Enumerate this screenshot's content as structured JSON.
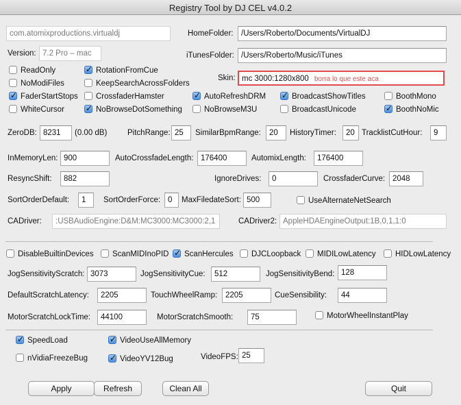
{
  "window": {
    "title": "Registry Tool by DJ CEL v4.0.2"
  },
  "top": {
    "bundle_id": "com.atomixproductions.virtualdj",
    "version_label": "Version:",
    "version_value": "7.2 Pro – mac",
    "home_folder_label": "HomeFolder:",
    "home_folder_value": "/Users/Roberto/Documents/VirtualDJ",
    "itunes_folder_label": "iTunesFolder:",
    "itunes_folder_value": "/Users/Roberto/Music/iTunes",
    "skin_label": "Skin:",
    "skin_value": "mc 3000:1280x800",
    "skin_hint": "borra lo que este aca"
  },
  "checks1": {
    "readonly": "ReadOnly",
    "rotation_from_cue": "RotationFromCue",
    "nomodifiles": "NoModiFiles",
    "keep_search": "KeepSearchAcrossFolders",
    "fader_start_stops": "FaderStartStops",
    "crossfader_hamster": "CrossfaderHamster",
    "auto_refresh_drm": "AutoRefreshDRM",
    "broadcast_show_titles": "BroadcastShowTitles",
    "booth_mono": "BoothMono",
    "white_cursor": "WhiteCursor",
    "no_browse_dot": "NoBrowseDotSomething",
    "no_browse_m3u": "NoBrowseM3U",
    "broadcast_unicode": "BroadcastUnicode",
    "booth_no_mic": "BoothNoMic"
  },
  "fields1": {
    "zerodb_label": "ZeroDB:",
    "zerodb_value": "8231",
    "zerodb_db": "(0.00 dB)",
    "pitch_range_label": "PitchRange:",
    "pitch_range_value": "25",
    "similar_bpm_label": "SimilarBpmRange:",
    "similar_bpm_value": "20",
    "history_timer_label": "HistoryTimer:",
    "history_timer_value": "20",
    "tracklist_cut_label": "TracklistCutHour:",
    "tracklist_cut_value": "9",
    "inmemory_label": "InMemoryLen:",
    "inmemory_value": "900",
    "auto_crossfade_label": "AutoCrossfadeLength:",
    "auto_crossfade_value": "176400",
    "automix_label": "AutomixLength:",
    "automix_value": "176400",
    "resync_label": "ResyncShift:",
    "resync_value": "882",
    "ignore_drives_label": "IgnoreDrives:",
    "ignore_drives_value": "0",
    "crossfader_curve_label": "CrossfaderCurve:",
    "crossfader_curve_value": "2048",
    "sort_default_label": "SortOrderDefault:",
    "sort_default_value": "1",
    "sort_force_label": "SortOrderForce:",
    "sort_force_value": "0",
    "max_filedate_label": "MaxFiledateSort:",
    "max_filedate_value": "500",
    "use_alt_net_search": "UseAlternateNetSearch",
    "cadriver_label": "CADriver:",
    "cadriver_value": ":USBAudioEngine:D&M:MC3000:MC3000:2,1",
    "cadriver2_label": "CADriver2:",
    "cadriver2_value": "AppleHDAEngineOutput:1B,0,1,1:0"
  },
  "checks2": {
    "disable_builtin": "DisableBuiltinDevices",
    "scan_midi_no_pid": "ScanMIDInoPID",
    "scan_hercules": "ScanHercules",
    "djc_loopback": "DJCLoopback",
    "midi_low_latency": "MIDILowLatency",
    "hid_low_latency": "HIDLowLatency"
  },
  "fields2": {
    "jog_scratch_label": "JogSensitivityScratch:",
    "jog_scratch_value": "3073",
    "jog_cue_label": "JogSensitivityCue:",
    "jog_cue_value": "512",
    "jog_bend_label": "JogSensitivityBend:",
    "jog_bend_value": "128",
    "default_scratch_label": "DefaultScratchLatency:",
    "default_scratch_value": "2205",
    "touch_wheel_label": "TouchWheelRamp:",
    "touch_wheel_value": "2205",
    "cue_sens_label": "CueSensibility:",
    "cue_sens_value": "44",
    "motor_lock_label": "MotorScratchLockTime:",
    "motor_lock_value": "44100",
    "motor_smooth_label": "MotorScratchSmooth:",
    "motor_smooth_value": "75",
    "motor_wheel_instant": "MotorWheelInstantPlay"
  },
  "checks3": {
    "speed_load": "SpeedLoad",
    "video_use_all_memory": "VideoUseAllMemory",
    "nvidia_freeze": "nVidiaFreezeBug",
    "video_yv12": "VideoYV12Bug",
    "video_fps_label": "VideoFPS:",
    "video_fps_value": "25"
  },
  "buttons": {
    "apply": "Apply",
    "refresh": "Refresh",
    "clean_all": "Clean All",
    "quit": "Quit"
  }
}
